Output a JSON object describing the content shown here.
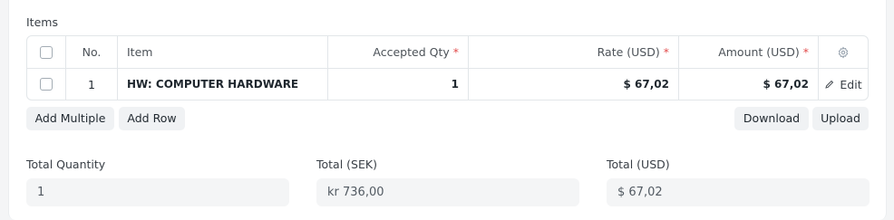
{
  "section": {
    "title": "Items"
  },
  "table": {
    "headers": {
      "no": "No.",
      "item": "Item",
      "accepted_qty": "Accepted Qty",
      "rate": "Rate (USD)",
      "amount": "Amount (USD)",
      "required_mark": "*"
    },
    "rows": [
      {
        "no": "1",
        "item": "HW: COMPUTER HARDWARE",
        "accepted_qty": "1",
        "rate": "$ 67,02",
        "amount": "$ 67,02",
        "edit_label": "Edit"
      }
    ]
  },
  "buttons": {
    "add_multiple": "Add Multiple",
    "add_row": "Add Row",
    "download": "Download",
    "upload": "Upload"
  },
  "totals": {
    "total_quantity_label": "Total Quantity",
    "total_quantity_value": "1",
    "total_sek_label": "Total (SEK)",
    "total_sek_value": "kr 736,00",
    "total_usd_label": "Total (USD)",
    "total_usd_value": "$ 67,02"
  },
  "icons": {
    "settings": "gear-icon",
    "edit": "pencil-icon"
  },
  "colors": {
    "required": "#e24c4c",
    "field_bg": "#f4f5f6",
    "button_bg": "#f0f2f4"
  }
}
